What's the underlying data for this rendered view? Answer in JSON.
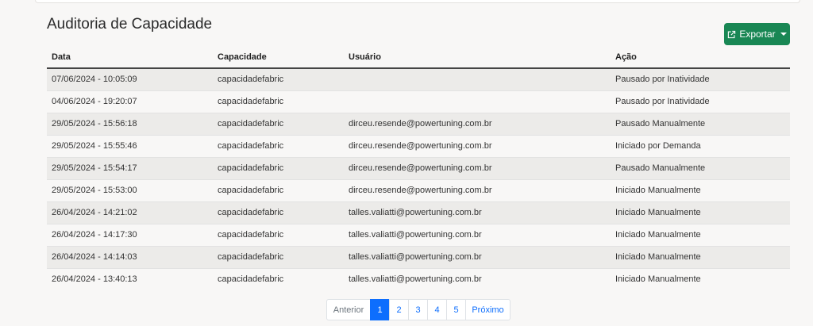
{
  "header": {
    "title": "Auditoria de Capacidade",
    "export_label": "Exportar"
  },
  "table": {
    "columns": [
      "Data",
      "Capacidade",
      "Usuário",
      "Ação"
    ],
    "rows": [
      [
        "07/06/2024 - 10:05:09",
        "capacidadefabric",
        "",
        "Pausado por Inatividade"
      ],
      [
        "04/06/2024 - 19:20:07",
        "capacidadefabric",
        "",
        "Pausado por Inatividade"
      ],
      [
        "29/05/2024 - 15:56:18",
        "capacidadefabric",
        "dirceu.resende@powertuning.com.br",
        "Pausado Manualmente"
      ],
      [
        "29/05/2024 - 15:55:46",
        "capacidadefabric",
        "dirceu.resende@powertuning.com.br",
        "Iniciado por Demanda"
      ],
      [
        "29/05/2024 - 15:54:17",
        "capacidadefabric",
        "dirceu.resende@powertuning.com.br",
        "Pausado Manualmente"
      ],
      [
        "29/05/2024 - 15:53:00",
        "capacidadefabric",
        "dirceu.resende@powertuning.com.br",
        "Iniciado Manualmente"
      ],
      [
        "26/04/2024 - 14:21:02",
        "capacidadefabric",
        "talles.valiatti@powertuning.com.br",
        "Iniciado Manualmente"
      ],
      [
        "26/04/2024 - 14:17:30",
        "capacidadefabric",
        "talles.valiatti@powertuning.com.br",
        "Iniciado Manualmente"
      ],
      [
        "26/04/2024 - 14:14:03",
        "capacidadefabric",
        "talles.valiatti@powertuning.com.br",
        "Iniciado Manualmente"
      ],
      [
        "26/04/2024 - 13:40:13",
        "capacidadefabric",
        "talles.valiatti@powertuning.com.br",
        "Iniciado Manualmente"
      ]
    ]
  },
  "pagination": {
    "prev_label": "Anterior",
    "pages": [
      "1",
      "2",
      "3",
      "4",
      "5"
    ],
    "active_page": "1",
    "next_label": "Próximo"
  },
  "colors": {
    "accent": "#0d6efd",
    "export": "#198754",
    "stripe": "#ecebe9"
  },
  "icons": {
    "export": "external-link-icon",
    "dropdown": "caret-down-icon"
  }
}
